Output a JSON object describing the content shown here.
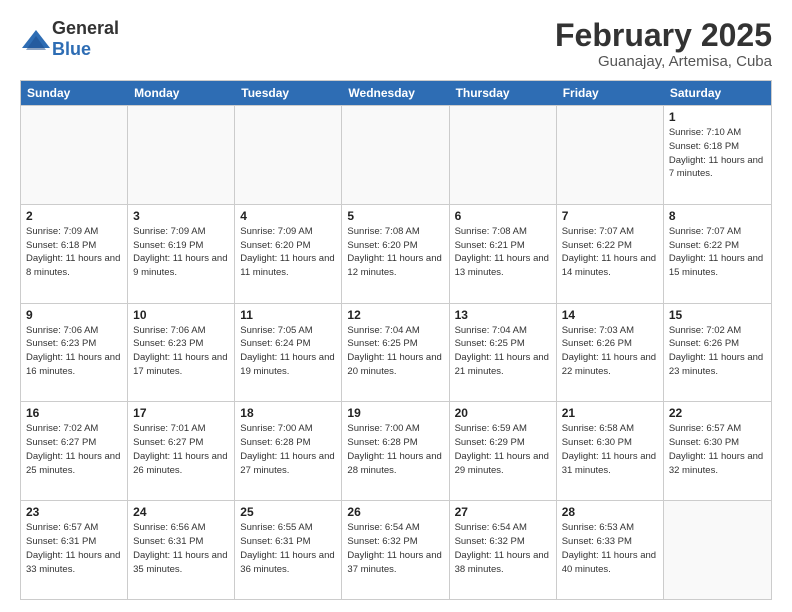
{
  "header": {
    "logo_general": "General",
    "logo_blue": "Blue",
    "title": "February 2025",
    "location": "Guanajay, Artemisa, Cuba"
  },
  "days_of_week": [
    "Sunday",
    "Monday",
    "Tuesday",
    "Wednesday",
    "Thursday",
    "Friday",
    "Saturday"
  ],
  "weeks": [
    [
      {
        "day": "",
        "info": ""
      },
      {
        "day": "",
        "info": ""
      },
      {
        "day": "",
        "info": ""
      },
      {
        "day": "",
        "info": ""
      },
      {
        "day": "",
        "info": ""
      },
      {
        "day": "",
        "info": ""
      },
      {
        "day": "1",
        "info": "Sunrise: 7:10 AM\nSunset: 6:18 PM\nDaylight: 11 hours and 7 minutes."
      }
    ],
    [
      {
        "day": "2",
        "info": "Sunrise: 7:09 AM\nSunset: 6:18 PM\nDaylight: 11 hours and 8 minutes."
      },
      {
        "day": "3",
        "info": "Sunrise: 7:09 AM\nSunset: 6:19 PM\nDaylight: 11 hours and 9 minutes."
      },
      {
        "day": "4",
        "info": "Sunrise: 7:09 AM\nSunset: 6:20 PM\nDaylight: 11 hours and 11 minutes."
      },
      {
        "day": "5",
        "info": "Sunrise: 7:08 AM\nSunset: 6:20 PM\nDaylight: 11 hours and 12 minutes."
      },
      {
        "day": "6",
        "info": "Sunrise: 7:08 AM\nSunset: 6:21 PM\nDaylight: 11 hours and 13 minutes."
      },
      {
        "day": "7",
        "info": "Sunrise: 7:07 AM\nSunset: 6:22 PM\nDaylight: 11 hours and 14 minutes."
      },
      {
        "day": "8",
        "info": "Sunrise: 7:07 AM\nSunset: 6:22 PM\nDaylight: 11 hours and 15 minutes."
      }
    ],
    [
      {
        "day": "9",
        "info": "Sunrise: 7:06 AM\nSunset: 6:23 PM\nDaylight: 11 hours and 16 minutes."
      },
      {
        "day": "10",
        "info": "Sunrise: 7:06 AM\nSunset: 6:23 PM\nDaylight: 11 hours and 17 minutes."
      },
      {
        "day": "11",
        "info": "Sunrise: 7:05 AM\nSunset: 6:24 PM\nDaylight: 11 hours and 19 minutes."
      },
      {
        "day": "12",
        "info": "Sunrise: 7:04 AM\nSunset: 6:25 PM\nDaylight: 11 hours and 20 minutes."
      },
      {
        "day": "13",
        "info": "Sunrise: 7:04 AM\nSunset: 6:25 PM\nDaylight: 11 hours and 21 minutes."
      },
      {
        "day": "14",
        "info": "Sunrise: 7:03 AM\nSunset: 6:26 PM\nDaylight: 11 hours and 22 minutes."
      },
      {
        "day": "15",
        "info": "Sunrise: 7:02 AM\nSunset: 6:26 PM\nDaylight: 11 hours and 23 minutes."
      }
    ],
    [
      {
        "day": "16",
        "info": "Sunrise: 7:02 AM\nSunset: 6:27 PM\nDaylight: 11 hours and 25 minutes."
      },
      {
        "day": "17",
        "info": "Sunrise: 7:01 AM\nSunset: 6:27 PM\nDaylight: 11 hours and 26 minutes."
      },
      {
        "day": "18",
        "info": "Sunrise: 7:00 AM\nSunset: 6:28 PM\nDaylight: 11 hours and 27 minutes."
      },
      {
        "day": "19",
        "info": "Sunrise: 7:00 AM\nSunset: 6:28 PM\nDaylight: 11 hours and 28 minutes."
      },
      {
        "day": "20",
        "info": "Sunrise: 6:59 AM\nSunset: 6:29 PM\nDaylight: 11 hours and 29 minutes."
      },
      {
        "day": "21",
        "info": "Sunrise: 6:58 AM\nSunset: 6:30 PM\nDaylight: 11 hours and 31 minutes."
      },
      {
        "day": "22",
        "info": "Sunrise: 6:57 AM\nSunset: 6:30 PM\nDaylight: 11 hours and 32 minutes."
      }
    ],
    [
      {
        "day": "23",
        "info": "Sunrise: 6:57 AM\nSunset: 6:31 PM\nDaylight: 11 hours and 33 minutes."
      },
      {
        "day": "24",
        "info": "Sunrise: 6:56 AM\nSunset: 6:31 PM\nDaylight: 11 hours and 35 minutes."
      },
      {
        "day": "25",
        "info": "Sunrise: 6:55 AM\nSunset: 6:31 PM\nDaylight: 11 hours and 36 minutes."
      },
      {
        "day": "26",
        "info": "Sunrise: 6:54 AM\nSunset: 6:32 PM\nDaylight: 11 hours and 37 minutes."
      },
      {
        "day": "27",
        "info": "Sunrise: 6:54 AM\nSunset: 6:32 PM\nDaylight: 11 hours and 38 minutes."
      },
      {
        "day": "28",
        "info": "Sunrise: 6:53 AM\nSunset: 6:33 PM\nDaylight: 11 hours and 40 minutes."
      },
      {
        "day": "",
        "info": ""
      }
    ]
  ]
}
